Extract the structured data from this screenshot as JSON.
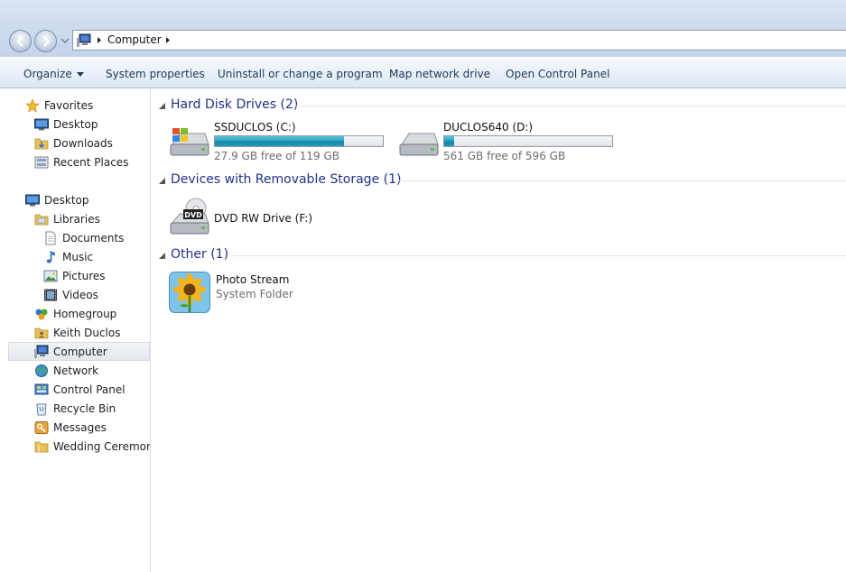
{
  "address_bar": {
    "path": [
      "Computer"
    ]
  },
  "command_bar": {
    "items": [
      {
        "label": "Organize",
        "has_menu": true
      },
      {
        "label": "System properties"
      },
      {
        "label": "Uninstall or change a program"
      },
      {
        "label": "Map network drive"
      },
      {
        "label": "Open Control Panel"
      }
    ]
  },
  "nav_pane": {
    "favorites": {
      "label": "Favorites",
      "items": [
        {
          "label": "Desktop",
          "icon": "desktop-icon"
        },
        {
          "label": "Downloads",
          "icon": "folder-icon"
        },
        {
          "label": "Recent Places",
          "icon": "recent-places-icon"
        }
      ]
    },
    "desktop": {
      "label": "Desktop",
      "items": [
        {
          "label": "Libraries",
          "icon": "libraries-icon"
        },
        {
          "label": "Documents",
          "icon": "document-icon"
        },
        {
          "label": "Music",
          "icon": "music-icon"
        },
        {
          "label": "Pictures",
          "icon": "pictures-icon"
        },
        {
          "label": "Videos",
          "icon": "videos-icon"
        },
        {
          "label": "Homegroup",
          "icon": "homegroup-icon"
        },
        {
          "label": "Keith Duclos",
          "icon": "user-folder-icon"
        },
        {
          "label": "Computer",
          "icon": "computer-icon",
          "selected": true
        },
        {
          "label": "Network",
          "icon": "network-icon"
        },
        {
          "label": "Control Panel",
          "icon": "control-panel-icon"
        },
        {
          "label": "Recycle Bin",
          "icon": "recycle-bin-icon"
        },
        {
          "label": "Messages",
          "icon": "messages-icon"
        },
        {
          "label": "Wedding Ceremonie",
          "icon": "folder-icon"
        }
      ]
    }
  },
  "groups": {
    "hard_disks": {
      "title": "Hard Disk Drives (2)",
      "drives": [
        {
          "name": "SSDUCLOS (C:)",
          "free_text": "27.9 GB free of 119 GB",
          "used_fraction": 0.77
        },
        {
          "name": "DUCLOS640 (D:)",
          "free_text": "561 GB free of 596 GB",
          "used_fraction": 0.06
        }
      ]
    },
    "removable": {
      "title": "Devices with Removable Storage (1)",
      "devices": [
        {
          "name": "DVD RW Drive (F:)",
          "badge": "DVD"
        }
      ]
    },
    "other": {
      "title": "Other (1)",
      "items": [
        {
          "name": "Photo Stream",
          "type": "System Folder"
        }
      ]
    }
  },
  "colors": {
    "group_title": "#1e3287",
    "bar_fill": "#26a0da",
    "command_text": "#1e395b"
  }
}
